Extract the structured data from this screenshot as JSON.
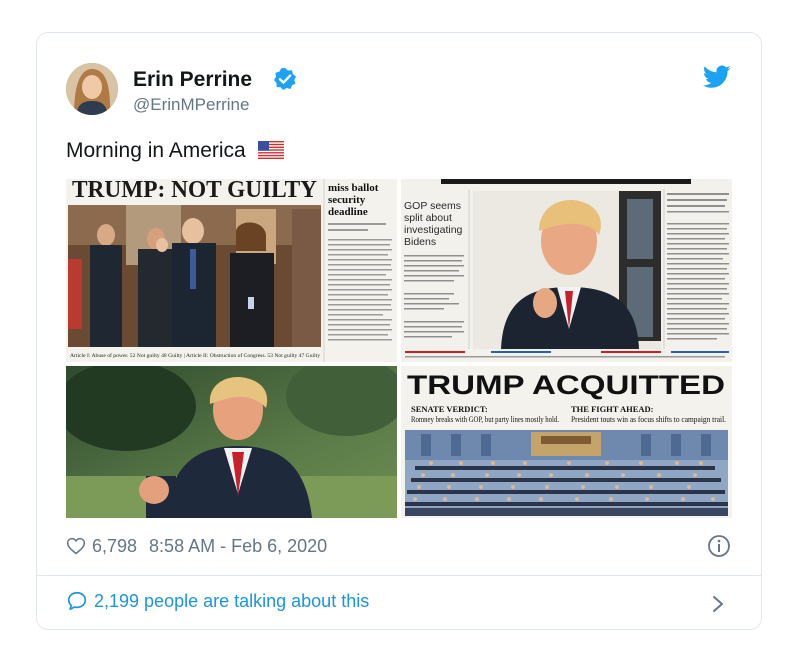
{
  "tweet": {
    "author_name": "Erin Perrine",
    "handle": "@ErinMPerrine",
    "text": "Morning in America",
    "likes": "6,798",
    "timestamp": "8:58 AM - Feb 6, 2020",
    "talking": "2,199 people are talking about this"
  },
  "media": {
    "panel1": {
      "headline": "TRUMP: NOT GUILTY",
      "side_headline": "miss ballot security deadline",
      "caption": "Article I: Abuse of power. 52 Not guilty 48 Guilty | Article II: Obstruction of Congress. 53 Not guilty 47 Guilty"
    },
    "panel2": {
      "side_headline": "GOP seems split about investigating Bidens"
    },
    "panel4": {
      "headline": "TRUMP ACQUITTED",
      "sub1_label": "SENATE VERDICT:",
      "sub1_text": "Romney breaks with GOP, but party lines mostly hold.",
      "sub2_label": "THE FIGHT AHEAD:",
      "sub2_text": "President touts win as focus shifts to campaign trail."
    }
  },
  "icons": {
    "verified": "verified-badge-icon",
    "brand": "twitter-bird-icon",
    "flag": "us-flag-emoji",
    "like": "heart-icon",
    "info": "info-icon",
    "reply": "speech-bubble-icon",
    "next": "chevron-right-icon"
  },
  "colors": {
    "accent": "#1da1f2",
    "link": "#1b95e0",
    "secondary": "#657786",
    "border": "#e1e8ed"
  }
}
